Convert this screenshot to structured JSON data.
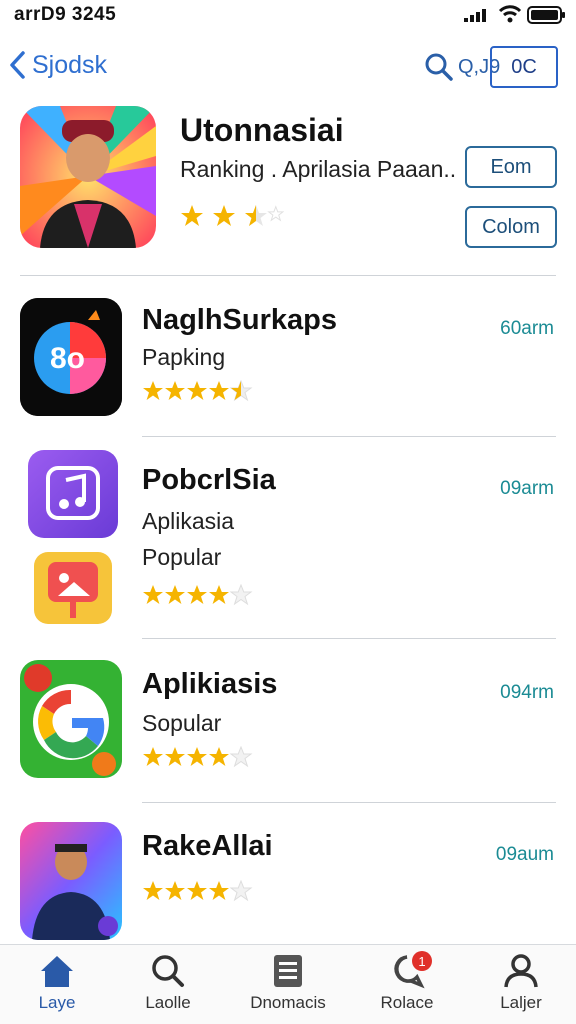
{
  "status": {
    "time": "arrD9 3245"
  },
  "nav": {
    "back_label": "Sjodsk",
    "search_label": "Q,J9",
    "pill_label": "0C"
  },
  "featured": {
    "title": "Utonnasiai",
    "subtitle": "Ranking . Aprilasia Paaan..",
    "rating": 2.5,
    "button1": "Eom",
    "button2": "Colom"
  },
  "apps": [
    {
      "name": "NaglhSurkaps",
      "desc": "Papking",
      "time": "60arm",
      "rating": 4.5
    },
    {
      "name": "PobcrlSia",
      "desc": "Aplikasia",
      "desc2": "Popular",
      "time": "09arm",
      "rating": 4
    },
    {
      "name": "Aplikiasis",
      "desc": "Sopular",
      "time": "094rm",
      "rating": 4
    },
    {
      "name": "RakeAllai",
      "time": "09aum",
      "rating": 4
    }
  ],
  "tabs": [
    {
      "label": "Laye",
      "icon": "home-icon"
    },
    {
      "label": "Laolle",
      "icon": "search-icon"
    },
    {
      "label": "Dnomacis",
      "icon": "document-icon"
    },
    {
      "label": "Rolace",
      "icon": "notification-icon",
      "badge": "1"
    },
    {
      "label": "Laljer",
      "icon": "profile-icon"
    }
  ],
  "colors": {
    "accent": "#2a5aa8",
    "time_teal": "#1b8b94",
    "star": "#f5b400"
  }
}
